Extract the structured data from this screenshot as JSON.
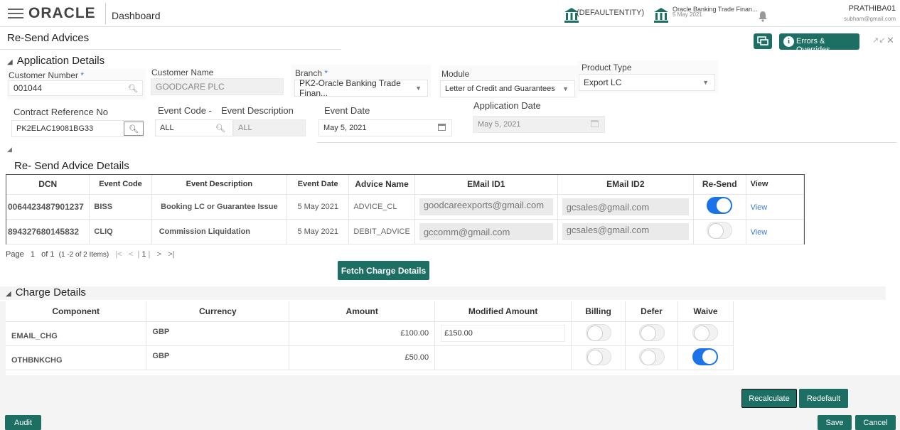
{
  "topbar": {
    "logo": "ORACLE",
    "app_title": "Dashboard",
    "entity": "(DEFAULTENTITY)",
    "bank_name": "Oracle Banking Trade Finan...",
    "bank_date": "5 May 2021",
    "user": "PRATHIBA01",
    "email": "subham@gmail.com"
  },
  "header": {
    "page_title": "Re-Send Advices",
    "errors_label": "Errors & Overrides"
  },
  "application": {
    "section_title": "Application Details",
    "customer_number_label": "Customer Number",
    "customer_number": "001044",
    "customer_name_label": "Customer Name",
    "customer_name": "GOODCARE PLC",
    "branch_label": "Branch",
    "branch": "PK2-Oracle Banking Trade Finan...",
    "module_label": "Module",
    "module": "Letter of Credit and Guarantees",
    "product_type_label": "Product Type",
    "product_type": "Export LC",
    "contract_ref_label": "Contract Reference No",
    "contract_ref": "PK2ELAC19081BG33",
    "event_code_label": "Event Code -",
    "event_desc_label": "Event Description",
    "event_code": "ALL",
    "event_desc": "ALL",
    "event_date_label": "Event Date",
    "event_date": "May 5, 2021",
    "application_date_label": "Application Date",
    "application_date": "May 5, 2021"
  },
  "advice": {
    "section_title": "Re- Send Advice Details",
    "columns": [
      "DCN",
      "Event Code",
      "Event Description",
      "Event Date",
      "Advice Name",
      "EMail ID1",
      "EMail ID2",
      "Re-Send",
      "View"
    ],
    "rows": [
      {
        "dcn": "0064423487901237",
        "event_code": "BISS",
        "event_desc": "Booking LC or Guarantee Issue",
        "event_date": "5 May 2021",
        "advice_name": "ADVICE_CL",
        "email1": "goodcareexports@gmail.com",
        "email2": "gcsales@gmail.com",
        "resend": true,
        "view": "View"
      },
      {
        "dcn": "894327680145832",
        "event_code": "CLIQ",
        "event_desc": "Commission Liquidation",
        "event_date": "5 May 2021",
        "advice_name": "DEBIT_ADVICE",
        "email1": "gccomm@gmail.com",
        "email2": "gcsales@gmail.com",
        "resend": false,
        "view": "View"
      }
    ],
    "pager": {
      "page_label": "Page",
      "page": "1",
      "of_label": "of",
      "total_pages": "1",
      "items": "(1 -2 of 2 Items)",
      "current": "1"
    },
    "fetch_label": "Fetch Charge Details"
  },
  "charges": {
    "section_title": "Charge Details",
    "columns": [
      "Component",
      "Currency",
      "Amount",
      "Modified Amount",
      "Billing",
      "Defer",
      "Waive"
    ],
    "rows": [
      {
        "component": "EMAIL_CHG",
        "currency": "GBP",
        "amount": "£100.00",
        "modified": "£150.00",
        "billing": false,
        "defer": false,
        "waive": false
      },
      {
        "component": "OTHBNKCHG",
        "currency": "GBP",
        "amount": "£50.00",
        "modified": "",
        "billing": false,
        "defer": false,
        "waive": true
      }
    ]
  },
  "footer": {
    "recalculate": "Recalculate",
    "redefault": "Redefault",
    "audit": "Audit",
    "save": "Save",
    "cancel": "Cancel"
  },
  "colors": {
    "accent": "#1d6f63",
    "toggle_on": "#1a73e8",
    "link": "#3a7bd5"
  }
}
